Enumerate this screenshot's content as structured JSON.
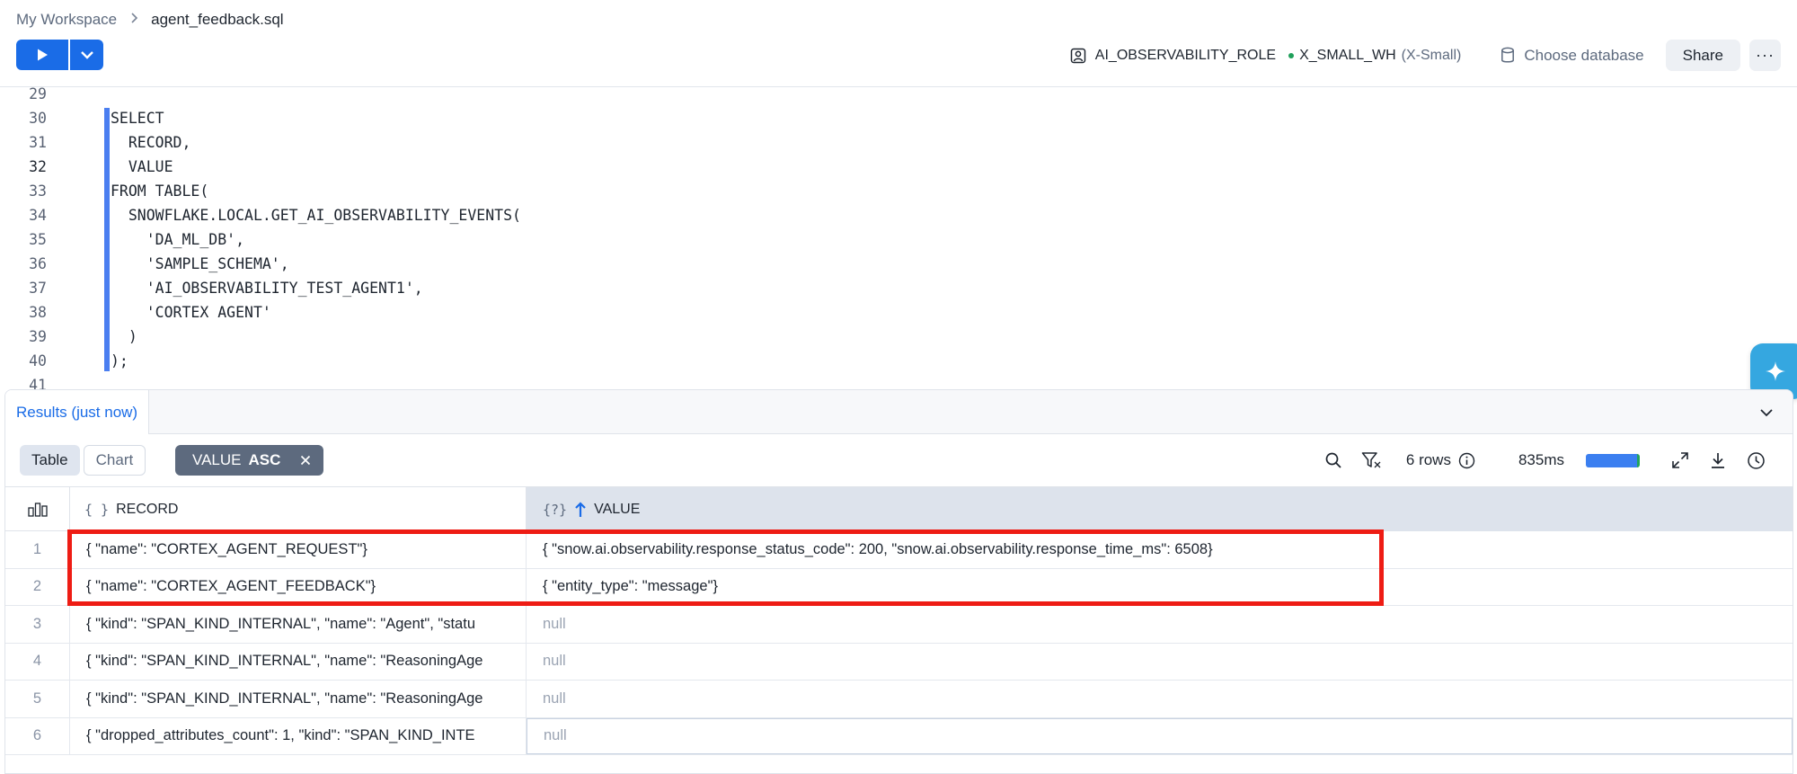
{
  "breadcrumb": {
    "root": "My Workspace",
    "file": "agent_feedback.sql"
  },
  "toolbar": {
    "role": "AI_OBSERVABILITY_ROLE",
    "warehouse": "X_SMALL_WH",
    "warehouse_size": "(X-Small)",
    "choose_database": "Choose database",
    "share": "Share",
    "more": "···"
  },
  "editor": {
    "lines": [
      {
        "num": "29",
        "code": ""
      },
      {
        "num": "30",
        "code": "SELECT"
      },
      {
        "num": "31",
        "code": "  RECORD,"
      },
      {
        "num": "32",
        "code": "  VALUE"
      },
      {
        "num": "33",
        "code": "FROM TABLE("
      },
      {
        "num": "34",
        "code": "  SNOWFLAKE.LOCAL.GET_AI_OBSERVABILITY_EVENTS("
      },
      {
        "num": "35",
        "code": "    'DA_ML_DB',"
      },
      {
        "num": "36",
        "code": "    'SAMPLE_SCHEMA',"
      },
      {
        "num": "37",
        "code": "    'AI_OBSERVABILITY_TEST_AGENT1',"
      },
      {
        "num": "38",
        "code": "    'CORTEX AGENT'"
      },
      {
        "num": "39",
        "code": "  )"
      },
      {
        "num": "40",
        "code": ");"
      },
      {
        "num": "41",
        "code": ""
      }
    ],
    "active_line": "32"
  },
  "results": {
    "tab_label": "Results (just now)",
    "view_table": "Table",
    "view_chart": "Chart",
    "sort_column": "VALUE",
    "sort_direction": "ASC",
    "row_count": "6 rows",
    "elapsed": "835ms",
    "progress": 0.95,
    "columns": {
      "record": {
        "type": "{ }",
        "label": "RECORD"
      },
      "value": {
        "type": "{?}",
        "label": "VALUE"
      }
    },
    "rows": [
      {
        "idx": "1",
        "record": "{  \"name\": \"CORTEX_AGENT_REQUEST\"}",
        "value": "{  \"snow.ai.observability.response_status_code\": 200,  \"snow.ai.observability.response_time_ms\": 6508}"
      },
      {
        "idx": "2",
        "record": "{  \"name\": \"CORTEX_AGENT_FEEDBACK\"}",
        "value": "{  \"entity_type\": \"message\"}"
      },
      {
        "idx": "3",
        "record": "{  \"kind\": \"SPAN_KIND_INTERNAL\",  \"name\": \"Agent\",  \"statu",
        "value": "null"
      },
      {
        "idx": "4",
        "record": "{  \"kind\": \"SPAN_KIND_INTERNAL\",  \"name\": \"ReasoningAge",
        "value": "null"
      },
      {
        "idx": "5",
        "record": "{  \"kind\": \"SPAN_KIND_INTERNAL\",  \"name\": \"ReasoningAge",
        "value": "null"
      },
      {
        "idx": "6",
        "record": "{  \"dropped_attributes_count\": 1,  \"kind\": \"SPAN_KIND_INTE",
        "value": "null"
      }
    ]
  },
  "colors": {
    "accent": "#1a6ce7",
    "highlight": "#ee1c14",
    "keyword": "#1b54c7",
    "string": "#9b1d1d",
    "ai_button": "#35a7e0"
  }
}
